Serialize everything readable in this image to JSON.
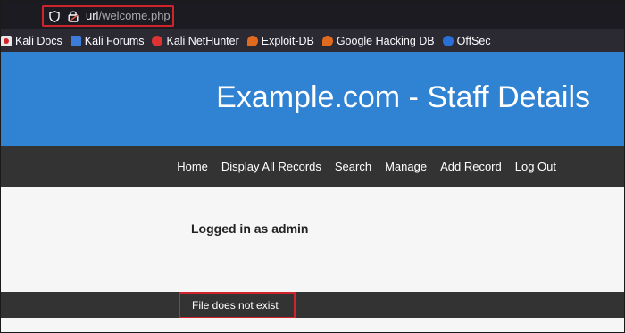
{
  "browser": {
    "url_host": "url",
    "url_path": "/welcome.php",
    "highlight_color": "#d0242c"
  },
  "bookmarks": [
    {
      "label": "Kali Docs",
      "icon": "kali-docs-icon"
    },
    {
      "label": "Kali Forums",
      "icon": "kali-forums-icon"
    },
    {
      "label": "Kali NetHunter",
      "icon": "kali-nethunter-icon"
    },
    {
      "label": "Exploit-DB",
      "icon": "exploit-db-icon"
    },
    {
      "label": "Google Hacking DB",
      "icon": "google-hacking-db-icon"
    },
    {
      "label": "OffSec",
      "icon": "offsec-icon"
    }
  ],
  "site": {
    "title": "Example.com - Staff Details",
    "header_color": "#2f83d2",
    "nav": [
      "Home",
      "Display All Records",
      "Search",
      "Manage",
      "Add Record",
      "Log Out"
    ],
    "logged_in_text": "Logged in as admin",
    "footer_text": "File does not exist"
  }
}
